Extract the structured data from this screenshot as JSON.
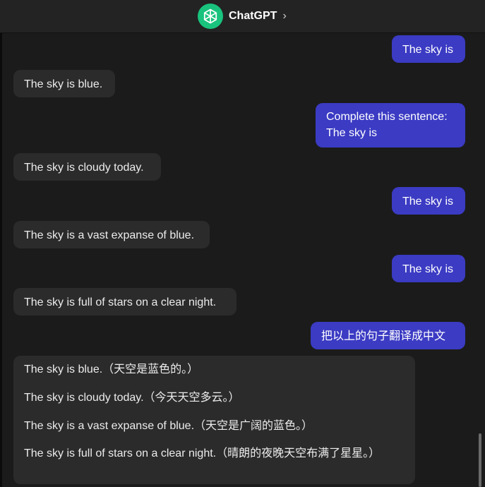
{
  "header": {
    "title": "ChatGPT",
    "chevron": "›",
    "logo_icon": "openai-logo-icon",
    "logo_color": "#19c37d"
  },
  "messages": [
    {
      "role": "user",
      "text": "The sky is"
    },
    {
      "role": "assistant",
      "text": "The sky is blue."
    },
    {
      "role": "user",
      "lines": [
        "Complete this sentence:",
        "The sky is"
      ]
    },
    {
      "role": "assistant",
      "text": "The sky is cloudy today."
    },
    {
      "role": "user",
      "text": "The sky is"
    },
    {
      "role": "assistant",
      "text": "The sky is a vast expanse of blue."
    },
    {
      "role": "user",
      "text": "The sky is"
    },
    {
      "role": "assistant",
      "text": "The sky is full of stars on a clear night."
    },
    {
      "role": "user",
      "text": "把以上的句子翻译成中文"
    },
    {
      "role": "assistant",
      "paragraphs": [
        "The sky is blue.（天空是蓝色的。）",
        "The sky is cloudy today.（今天天空多云。）",
        "The sky is a vast expanse of blue.（天空是广阔的蓝色。）",
        "The sky is full of stars on a clear night.（晴朗的夜晚天空布满了星星。）"
      ]
    }
  ],
  "colors": {
    "user_bubble": "#3b3bc4",
    "assistant_bubble": "#2b2b2b",
    "background": "#1b1b1b"
  }
}
